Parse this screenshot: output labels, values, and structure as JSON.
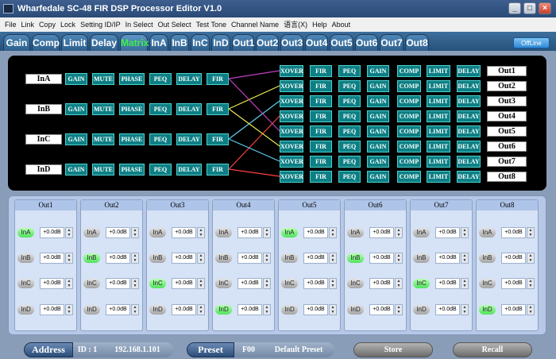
{
  "window": {
    "title": "Wharfedale SC-48 FIR DSP Processor Editor V1.0"
  },
  "menu": [
    "File",
    "Link",
    "Copy",
    "Lock",
    "Setting ID/IP",
    "In Select",
    "Out Select",
    "Test Tone",
    "Channel Name",
    "语言(X)",
    "Help",
    "About"
  ],
  "tabs": [
    "Gain",
    "Comp",
    "Limit",
    "Delay",
    "Matrix",
    "InA",
    "InB",
    "InC",
    "InD",
    "Out1",
    "Out2",
    "Out3",
    "Out4",
    "Out5",
    "Out6",
    "Out7",
    "Out8"
  ],
  "active_tab": "Matrix",
  "offline_label": "OffLine",
  "inputs": {
    "labels": [
      "InA",
      "InB",
      "InC",
      "InD"
    ],
    "chain": [
      "GAIN",
      "MUTE",
      "PHASE",
      "PEQ",
      "DELAY",
      "FIR"
    ]
  },
  "outputs": {
    "labels": [
      "Out1",
      "Out2",
      "Out3",
      "Out4",
      "Out5",
      "Out6",
      "Out7",
      "Out8"
    ],
    "chain": [
      "XOVER",
      "FIR",
      "PEQ",
      "GAIN",
      "COMP",
      "LIMIT",
      "DELAY"
    ]
  },
  "routing_colors": [
    "#c040c0",
    "#e8e850",
    "#60d0f0",
    "#ff4040"
  ],
  "mixer": {
    "columns": [
      {
        "title": "Out1",
        "rows": [
          {
            "ch": "InA",
            "on": true,
            "val": "+0.0dB"
          },
          {
            "ch": "InB",
            "on": false,
            "val": "+0.0dB"
          },
          {
            "ch": "InC",
            "on": false,
            "val": "+0.0dB"
          },
          {
            "ch": "InD",
            "on": false,
            "val": "+0.0dB"
          }
        ]
      },
      {
        "title": "Out2",
        "rows": [
          {
            "ch": "InA",
            "on": false,
            "val": "+0.0dB"
          },
          {
            "ch": "InB",
            "on": true,
            "val": "+0.0dB"
          },
          {
            "ch": "InC",
            "on": false,
            "val": "+0.0dB"
          },
          {
            "ch": "InD",
            "on": false,
            "val": "+0.0dB"
          }
        ]
      },
      {
        "title": "Out3",
        "rows": [
          {
            "ch": "InA",
            "on": false,
            "val": "+0.0dB"
          },
          {
            "ch": "InB",
            "on": false,
            "val": "+0.0dB"
          },
          {
            "ch": "InC",
            "on": true,
            "val": "+0.0dB"
          },
          {
            "ch": "InD",
            "on": false,
            "val": "+0.0dB"
          }
        ]
      },
      {
        "title": "Out4",
        "rows": [
          {
            "ch": "InA",
            "on": false,
            "val": "+0.0dB"
          },
          {
            "ch": "InB",
            "on": false,
            "val": "+0.0dB"
          },
          {
            "ch": "InC",
            "on": false,
            "val": "+0.0dB"
          },
          {
            "ch": "InD",
            "on": true,
            "val": "+0.0dB"
          }
        ]
      },
      {
        "title": "Out5",
        "rows": [
          {
            "ch": "InA",
            "on": true,
            "val": "+0.0dB"
          },
          {
            "ch": "InB",
            "on": false,
            "val": "+0.0dB"
          },
          {
            "ch": "InC",
            "on": false,
            "val": "+0.0dB"
          },
          {
            "ch": "InD",
            "on": false,
            "val": "+0.0dB"
          }
        ]
      },
      {
        "title": "Out6",
        "rows": [
          {
            "ch": "InA",
            "on": false,
            "val": "+0.0dB"
          },
          {
            "ch": "InB",
            "on": true,
            "val": "+0.0dB"
          },
          {
            "ch": "InC",
            "on": false,
            "val": "+0.0dB"
          },
          {
            "ch": "InD",
            "on": false,
            "val": "+0.0dB"
          }
        ]
      },
      {
        "title": "Out7",
        "rows": [
          {
            "ch": "InA",
            "on": false,
            "val": "+0.0dB"
          },
          {
            "ch": "InB",
            "on": false,
            "val": "+0.0dB"
          },
          {
            "ch": "InC",
            "on": true,
            "val": "+0.0dB"
          },
          {
            "ch": "InD",
            "on": false,
            "val": "+0.0dB"
          }
        ]
      },
      {
        "title": "Out8",
        "rows": [
          {
            "ch": "InA",
            "on": false,
            "val": "+0.0dB"
          },
          {
            "ch": "InB",
            "on": false,
            "val": "+0.0dB"
          },
          {
            "ch": "InC",
            "on": false,
            "val": "+0.0dB"
          },
          {
            "ch": "InD",
            "on": true,
            "val": "+0.0dB"
          }
        ]
      }
    ]
  },
  "status": {
    "address_label": "Address",
    "id": "ID : 1",
    "ip": "192.168.1.101",
    "preset_label": "Preset",
    "preset_num": "F00",
    "preset_name": "Default Preset",
    "store": "Store",
    "recall": "Recall"
  }
}
